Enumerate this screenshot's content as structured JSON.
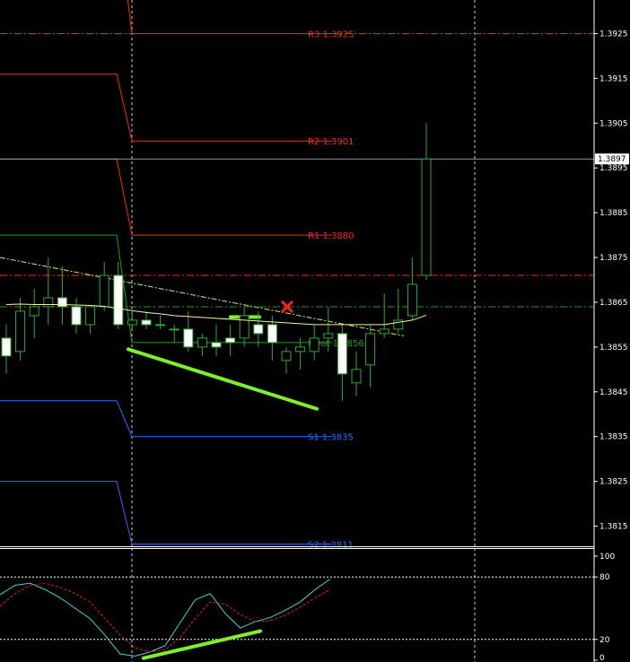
{
  "chart_data": {
    "type": "candlestick",
    "price_axis": {
      "ylim": [
        1.38105,
        1.39325
      ],
      "ticks": [
        "1.3925",
        "1.3915",
        "1.3905",
        "1.3895",
        "1.3885",
        "1.3875",
        "1.3865",
        "1.3855",
        "1.3845",
        "1.3835",
        "1.3825",
        "1.3815"
      ],
      "current_price_label": "1.3897",
      "current_price": 1.3897
    },
    "pivot_levels": [
      {
        "label": "R3 1.3925",
        "value": 1.3925,
        "color": "#ff2a00"
      },
      {
        "label": "R2 1.3901",
        "value": 1.3901,
        "color": "#ff2a00"
      },
      {
        "label": "R1 1.3880",
        "value": 1.388,
        "color": "#ff2a00"
      },
      {
        "label": "Pivot 1.3856",
        "value": 1.3856,
        "color": "#1aa01a"
      },
      {
        "label": "S1 1.3835",
        "value": 1.3835,
        "color": "#2a6cff"
      },
      {
        "label": "S2 1.3811",
        "value": 1.3811,
        "color": "#2a6cff"
      }
    ],
    "previous_day_levels": [
      {
        "name": "r3",
        "value": 1.3953,
        "color": "#ff2a00"
      },
      {
        "name": "r2",
        "value": 1.3916,
        "color": "#ff2a00"
      },
      {
        "name": "r1",
        "value": 1.3897,
        "color": "#ff2a00"
      },
      {
        "name": "pivot",
        "value": 1.388,
        "color": "#1aa01a"
      },
      {
        "name": "s1",
        "value": 1.3843,
        "color": "#2a6cff"
      },
      {
        "name": "s2",
        "value": 1.3825,
        "color": "#2a6cff"
      }
    ],
    "horizontal_lines": [
      {
        "value": 1.3925,
        "color": "#ff2a00",
        "style": "dashdot"
      },
      {
        "value": 1.3871,
        "color": "#ff2a00",
        "style": "dashdot"
      },
      {
        "value": 1.3864,
        "color": "#1aa01a",
        "style": "dashdot"
      },
      {
        "value": 1.3897,
        "color": "#8a9bb0",
        "style": "solid"
      }
    ],
    "candles": [
      {
        "o": 1.3857,
        "h": 1.386,
        "l": 1.3849,
        "c": 1.3853
      },
      {
        "o": 1.3854,
        "h": 1.3866,
        "l": 1.3852,
        "c": 1.3863
      },
      {
        "o": 1.3862,
        "h": 1.3868,
        "l": 1.3857,
        "c": 1.3864
      },
      {
        "o": 1.3864,
        "h": 1.3875,
        "l": 1.386,
        "c": 1.3866
      },
      {
        "o": 1.3866,
        "h": 1.3873,
        "l": 1.386,
        "c": 1.3864
      },
      {
        "o": 1.3864,
        "h": 1.3866,
        "l": 1.3858,
        "c": 1.386
      },
      {
        "o": 1.386,
        "h": 1.3864,
        "l": 1.3858,
        "c": 1.3864
      },
      {
        "o": 1.3864,
        "h": 1.3874,
        "l": 1.3863,
        "c": 1.3871
      },
      {
        "o": 1.3871,
        "h": 1.3874,
        "l": 1.3859,
        "c": 1.386
      },
      {
        "o": 1.386,
        "h": 1.3863,
        "l": 1.3859,
        "c": 1.3861
      },
      {
        "o": 1.3861,
        "h": 1.3863,
        "l": 1.3859,
        "c": 1.386
      },
      {
        "o": 1.386,
        "h": 1.3862,
        "l": 1.3859,
        "c": 1.386
      },
      {
        "o": 1.3859,
        "h": 1.386,
        "l": 1.3856,
        "c": 1.3859
      },
      {
        "o": 1.3859,
        "h": 1.3863,
        "l": 1.3854,
        "c": 1.3855
      },
      {
        "o": 1.3855,
        "h": 1.3858,
        "l": 1.3853,
        "c": 1.3857
      },
      {
        "o": 1.3856,
        "h": 1.386,
        "l": 1.3853,
        "c": 1.3855
      },
      {
        "o": 1.3857,
        "h": 1.386,
        "l": 1.3853,
        "c": 1.3856
      },
      {
        "o": 1.3857,
        "h": 1.3864,
        "l": 1.3855,
        "c": 1.3862
      },
      {
        "o": 1.386,
        "h": 1.3863,
        "l": 1.3855,
        "c": 1.3858
      },
      {
        "o": 1.386,
        "h": 1.3862,
        "l": 1.3852,
        "c": 1.3856
      },
      {
        "o": 1.3852,
        "h": 1.3855,
        "l": 1.3849,
        "c": 1.3854
      },
      {
        "o": 1.3854,
        "h": 1.3857,
        "l": 1.385,
        "c": 1.3855
      },
      {
        "o": 1.3854,
        "h": 1.386,
        "l": 1.3852,
        "c": 1.3857
      },
      {
        "o": 1.3857,
        "h": 1.3864,
        "l": 1.3854,
        "c": 1.3858
      },
      {
        "o": 1.3858,
        "h": 1.386,
        "l": 1.3843,
        "c": 1.3849
      },
      {
        "o": 1.3847,
        "h": 1.3854,
        "l": 1.3844,
        "c": 1.385
      },
      {
        "o": 1.3851,
        "h": 1.386,
        "l": 1.3846,
        "c": 1.3858
      },
      {
        "o": 1.3858,
        "h": 1.3867,
        "l": 1.3857,
        "c": 1.3859
      },
      {
        "o": 1.3859,
        "h": 1.3868,
        "l": 1.3858,
        "c": 1.3861
      },
      {
        "o": 1.3862,
        "h": 1.3875,
        "l": 1.3861,
        "c": 1.3869
      },
      {
        "o": 1.3871,
        "h": 1.3905,
        "l": 1.387,
        "c": 1.3897
      }
    ],
    "moving_average": [
      1.38645,
      1.38646,
      1.38645,
      1.38645,
      1.38645,
      1.38644,
      1.38643,
      1.38641,
      1.38636,
      1.38631,
      1.38627,
      1.38624,
      1.3862,
      1.38618,
      1.38616,
      1.38614,
      1.38612,
      1.3861,
      1.38608,
      1.38606,
      1.38604,
      1.38602,
      1.386,
      1.386,
      1.386,
      1.386,
      1.386,
      1.386,
      1.38605,
      1.3861,
      1.38621
    ],
    "stochastic": {
      "ylim": [
        0,
        100
      ],
      "levels": [
        20,
        80
      ],
      "ticks": [
        "100",
        "80",
        "20",
        "0"
      ],
      "main": [
        63,
        72,
        74,
        68,
        60,
        50,
        40,
        24,
        6,
        4,
        8,
        14,
        36,
        58,
        64,
        45,
        31,
        37,
        41,
        48,
        56,
        68,
        78
      ],
      "signal": [
        52,
        64,
        72,
        74,
        70,
        64,
        56,
        40,
        24,
        12,
        8,
        10,
        22,
        40,
        56,
        54,
        44,
        37,
        38,
        43,
        51,
        60,
        68
      ]
    }
  }
}
